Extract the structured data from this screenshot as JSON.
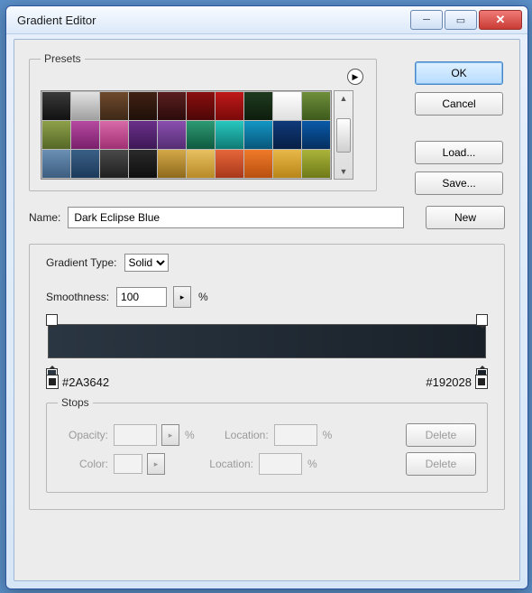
{
  "window": {
    "title": "Gradient Editor"
  },
  "buttons": {
    "ok": "OK",
    "cancel": "Cancel",
    "load": "Load...",
    "save": "Save...",
    "new": "New",
    "delete": "Delete"
  },
  "presets": {
    "legend": "Presets",
    "swatches": [
      [
        "#3a3a3a",
        "#111111"
      ],
      [
        "#e2e2e2",
        "#9f9f9f"
      ],
      [
        "#6f4a2c",
        "#3d2817"
      ],
      [
        "#412214",
        "#1f0f08"
      ],
      [
        "#5a1f1f",
        "#2c0b0b"
      ],
      [
        "#8a0f0f",
        "#4d0606"
      ],
      [
        "#bf1818",
        "#7a0a0a"
      ],
      [
        "#1f3a1f",
        "#0d1d0d"
      ],
      [
        "#ffffff",
        "#e0e0e0"
      ],
      [
        "#6f8f3a",
        "#3d5a1c"
      ],
      [
        "#8fa04a",
        "#556826"
      ],
      [
        "#b64aa0",
        "#7a1f6b"
      ],
      [
        "#d86aa8",
        "#a02f74"
      ],
      [
        "#6a2f8a",
        "#3d1855"
      ],
      [
        "#8a4fae",
        "#552d74"
      ],
      [
        "#2d9a74",
        "#0f5a40"
      ],
      [
        "#28c8c0",
        "#0f7a74"
      ],
      [
        "#1396c4",
        "#08567a"
      ],
      [
        "#0f3a7a",
        "#061f45"
      ],
      [
        "#0a5aa8",
        "#042f5f"
      ],
      [
        "#6a90b4",
        "#3d5d80"
      ],
      [
        "#3a5f86",
        "#1c3a5a"
      ],
      [
        "#4a4a4a",
        "#1f1f1f"
      ],
      [
        "#2a2a2a",
        "#0e0e0e"
      ],
      [
        "#d4a848",
        "#8f6a1c"
      ],
      [
        "#e8c060",
        "#b88a28"
      ],
      [
        "#e6663a",
        "#a8381a"
      ],
      [
        "#f07a2a",
        "#b8500f"
      ],
      [
        "#e8b848",
        "#b88618"
      ],
      [
        "#aab43a",
        "#6f7a18"
      ]
    ]
  },
  "name": {
    "label": "Name:",
    "value": "Dark Eclipse Blue"
  },
  "gradient": {
    "type_label": "Gradient Type:",
    "type_value": "Solid",
    "smooth_label": "Smoothness:",
    "smooth_value": "100",
    "left_hex": "#2A3642",
    "right_hex": "#192028"
  },
  "stops": {
    "legend": "Stops",
    "opacity_label": "Opacity:",
    "color_label": "Color:",
    "location_label": "Location:",
    "pct": "%"
  }
}
